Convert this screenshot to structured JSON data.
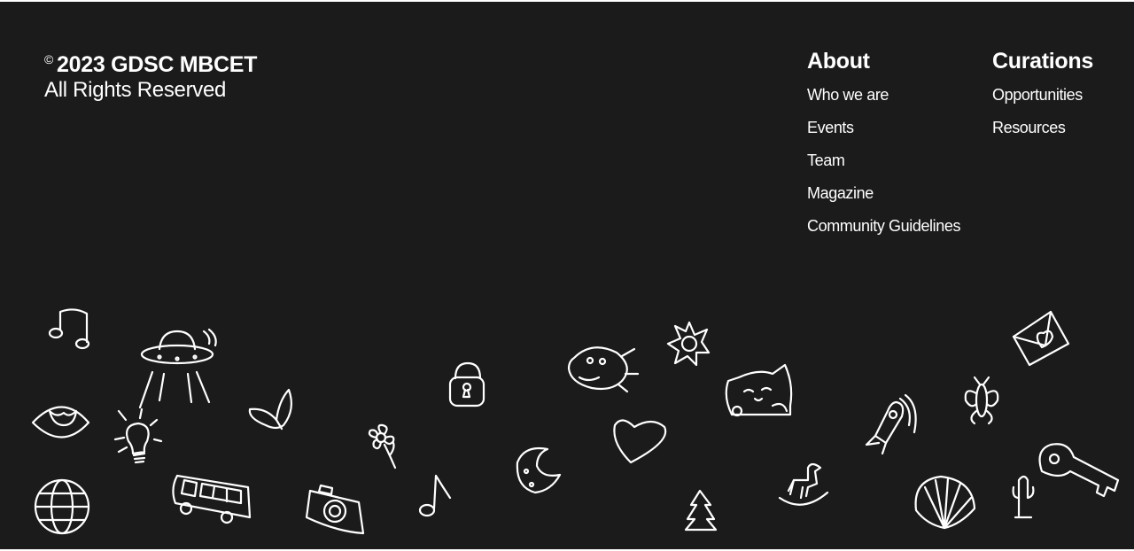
{
  "copyright": {
    "symbol": "©",
    "line1": "2023 GDSC MBCET",
    "line2": "All Rights Reserved"
  },
  "about": {
    "heading": "About",
    "links": [
      "Who we are",
      "Events",
      "Team",
      "Magazine",
      "Community Guidelines"
    ]
  },
  "curations": {
    "heading": "Curations",
    "links": [
      "Opportunities",
      "Resources"
    ]
  },
  "colors": {
    "background": "#1b1b1b",
    "text": "#ffffff",
    "doodle_stroke": "#ffffff"
  },
  "doodles": [
    "music-note-icon",
    "ufo-icon",
    "eye-icon",
    "lightbulb-icon",
    "globe-icon",
    "bus-icon",
    "butterfly-icon",
    "camera-icon",
    "flower-icon",
    "eighth-note-icon",
    "padlock-icon",
    "moon-icon",
    "fish-icon",
    "heart-icon",
    "sun-icon",
    "pine-tree-icon",
    "cat-icon",
    "rocking-horse-icon",
    "rocket-icon",
    "seashell-icon",
    "bee-icon",
    "cactus-icon",
    "envelope-icon",
    "key-icon"
  ]
}
